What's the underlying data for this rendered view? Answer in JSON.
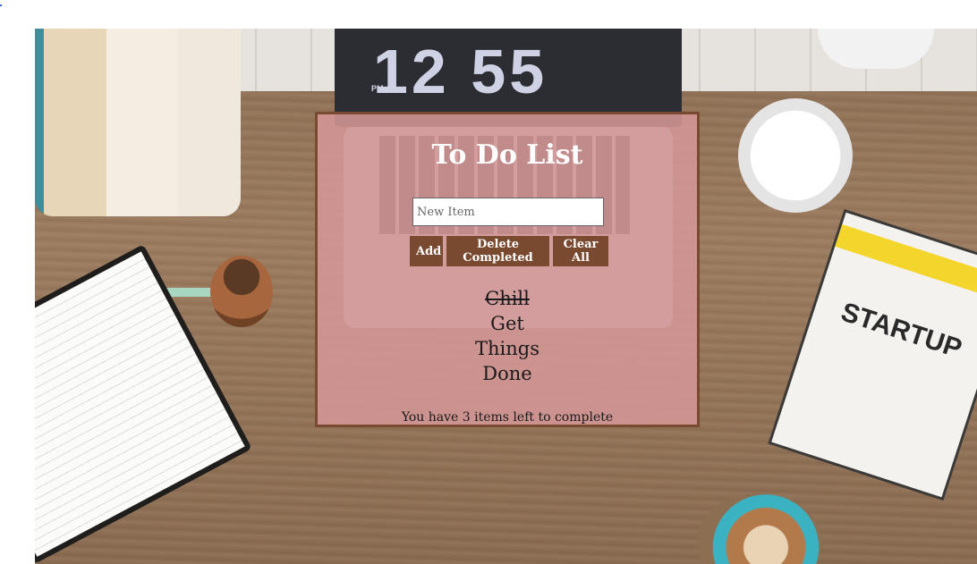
{
  "app": {
    "title": "To Do List"
  },
  "input": {
    "placeholder": "New Item",
    "value": ""
  },
  "buttons": {
    "add": "Add",
    "delete_completed": "Delete Completed",
    "clear_all": "Clear All"
  },
  "items": [
    {
      "label": "Chill",
      "completed": true
    },
    {
      "label": "Get",
      "completed": false
    },
    {
      "label": "Things",
      "completed": false
    },
    {
      "label": "Done",
      "completed": false
    }
  ],
  "status": {
    "text": "You have 3 items left to complete"
  },
  "background": {
    "clock_time": "12 55",
    "clock_period": "PM",
    "book_title": "STARTUP"
  },
  "colors": {
    "panel_bg": "#d49696",
    "panel_border": "#7a4a30",
    "button_bg": "#7a4a30",
    "title_text": "#ffffff"
  }
}
